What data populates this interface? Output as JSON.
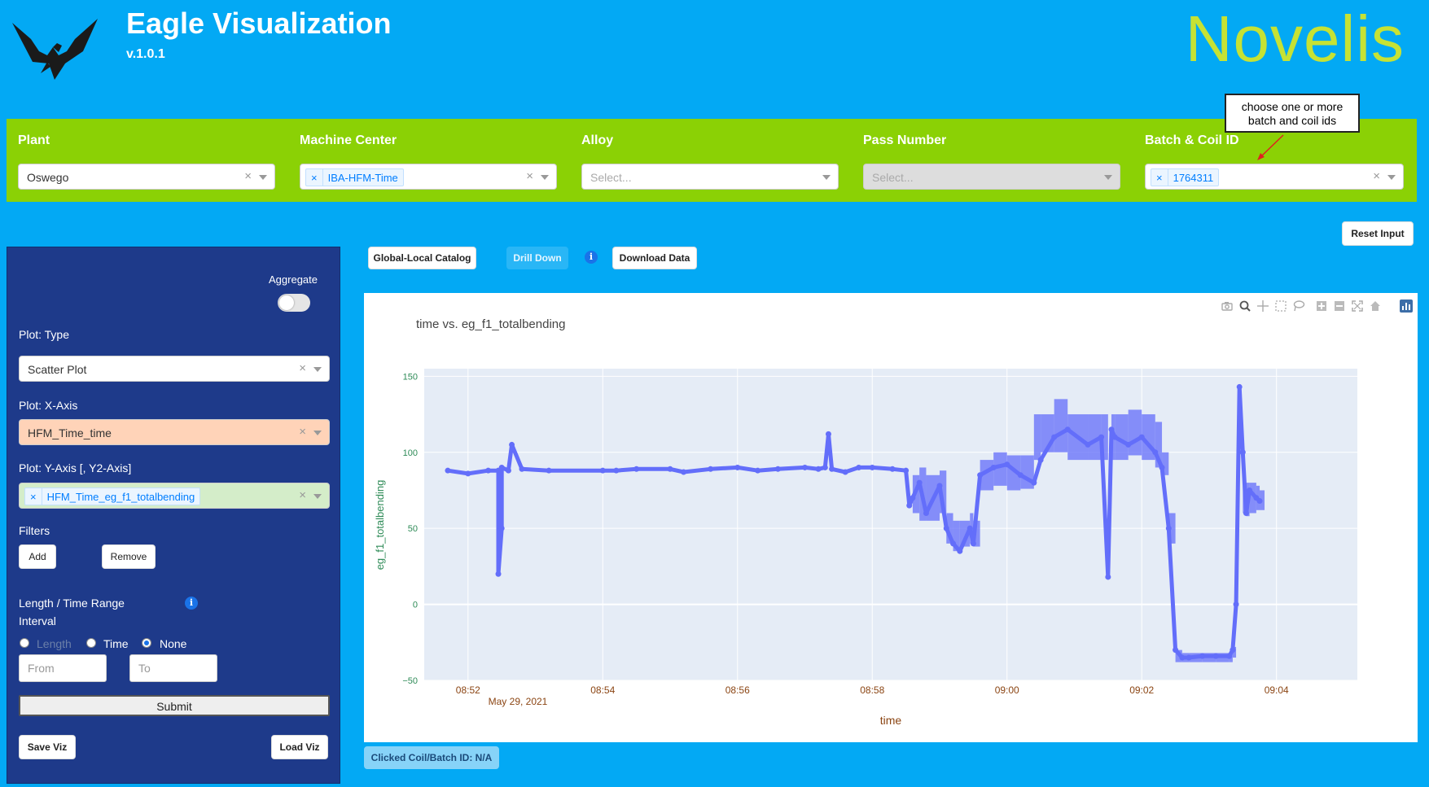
{
  "header": {
    "title": "Eagle Visualization",
    "version": "v.1.0.1",
    "brand": "Novelis"
  },
  "filters": {
    "plant": {
      "label": "Plant",
      "value": "Oswego"
    },
    "machine_center": {
      "label": "Machine Center",
      "chip": "IBA-HFM-Time"
    },
    "alloy": {
      "label": "Alloy",
      "placeholder": "Select..."
    },
    "pass_number": {
      "label": "Pass Number",
      "placeholder": "Select..."
    },
    "batch_coil": {
      "label": "Batch & Coil ID",
      "chip": "1764311"
    }
  },
  "tooltip": "choose one or more batch and coil ids",
  "buttons": {
    "reset": "Reset Input",
    "catalog": "Global-Local Catalog",
    "drill_down": "Drill Down",
    "download": "Download Data",
    "save_viz": "Save Viz",
    "load_viz": "Load Viz",
    "add": "Add",
    "remove": "Remove",
    "submit": "Submit",
    "info_glyph": "i",
    "clear_glyph": "×"
  },
  "sidebar": {
    "aggregate": "Aggregate",
    "plot_type_label": "Plot: Type",
    "plot_type_value": "Scatter Plot",
    "x_axis_label": "Plot: X-Axis",
    "x_axis_value": "HFM_Time_time",
    "y_axis_label": "Plot: Y-Axis [, Y2-Axis]",
    "y_axis_chip": "HFM_Time_eg_f1_totalbending",
    "filters_label": "Filters",
    "range_label_1": "Length / Time Range",
    "range_label_2": "Interval",
    "radio_length": "Length",
    "radio_time": "Time",
    "radio_none": "None",
    "from_placeholder": "From",
    "to_placeholder": "To"
  },
  "status": "Clicked Coil/Batch ID: N/A",
  "colors": {
    "background": "#03A9F4",
    "filter_bar": "#8BD105",
    "sidebar": "#1E3A8A",
    "brand": "#C6E234",
    "series": "#636EFA",
    "plot_bg": "#E5ECF6"
  },
  "icons": [
    "eagle-logo",
    "camera-icon",
    "zoom-icon",
    "pan-icon",
    "box-select-icon",
    "lasso-icon",
    "zoom-in-icon",
    "zoom-out-icon",
    "autoscale-icon",
    "home-icon",
    "plotly-logo-icon"
  ],
  "chart_data": {
    "type": "scatter",
    "title": "time vs. eg_f1_totalbending",
    "xlabel": "time",
    "ylabel": "eg_f1_totalbending",
    "x_ticks": [
      "08:52",
      "08:54",
      "08:56",
      "08:58",
      "09:00",
      "09:02",
      "09:04"
    ],
    "x_date_label": "May 29, 2021",
    "y_ticks": [
      "150",
      "100",
      "50",
      "0",
      "−50"
    ],
    "ylim": [
      -50,
      155
    ],
    "xlim_minutes": [
      51.35,
      65.2
    ],
    "grid": true,
    "series": [
      {
        "x": [
          51.7,
          52.0,
          52.3,
          52.45,
          52.45,
          52.5,
          52.5,
          52.6,
          52.65,
          52.8,
          53.2,
          54.0,
          54.2,
          54.5,
          55.0,
          55.2,
          55.6,
          56.0,
          56.3,
          56.6,
          57.0,
          57.2,
          57.3,
          57.35,
          57.4,
          57.6,
          57.8,
          58.0,
          58.3,
          58.5,
          58.55,
          58.6,
          58.7,
          58.8,
          59.0,
          59.1,
          59.2,
          59.3,
          59.45,
          59.5,
          59.6,
          59.8,
          60.0,
          60.2,
          60.4,
          60.5,
          60.7,
          60.9,
          61.2,
          61.4,
          61.5,
          61.55,
          61.6,
          61.8,
          62.0,
          62.2,
          62.3,
          62.4,
          62.5,
          62.6,
          62.7,
          62.9,
          63.1,
          63.3,
          63.35,
          63.4,
          63.45,
          63.5,
          63.55,
          63.6,
          63.7,
          63.75
        ],
        "y": [
          88,
          86,
          88,
          88,
          20,
          50,
          90,
          88,
          105,
          89,
          88,
          88,
          88,
          89,
          89,
          87,
          89,
          90,
          88,
          89,
          90,
          89,
          90,
          112,
          89,
          87,
          90,
          90,
          89,
          88,
          65,
          70,
          80,
          60,
          78,
          50,
          40,
          35,
          50,
          40,
          85,
          90,
          92,
          85,
          80,
          95,
          110,
          115,
          105,
          110,
          18,
          115,
          110,
          105,
          110,
          100,
          90,
          50,
          -30,
          -35,
          -35,
          -34,
          -34,
          -34,
          -30,
          0,
          143,
          100,
          60,
          75,
          70,
          68
        ],
        "band_low": [
          null,
          null,
          null,
          null,
          null,
          null,
          null,
          null,
          null,
          null,
          null,
          null,
          null,
          null,
          null,
          null,
          null,
          null,
          null,
          null,
          null,
          null,
          null,
          null,
          null,
          null,
          null,
          null,
          null,
          null,
          null,
          60,
          55,
          55,
          60,
          40,
          35,
          38,
          40,
          38,
          75,
          78,
          75,
          76,
          95,
          100,
          100,
          95,
          95,
          95,
          null,
          95,
          95,
          98,
          95,
          90,
          85,
          40,
          -38,
          -38,
          -38,
          -38,
          -38,
          -38,
          -35,
          null,
          null,
          60,
          58,
          60,
          62,
          62
        ],
        "band_high": [
          null,
          null,
          null,
          null,
          null,
          null,
          null,
          null,
          null,
          null,
          null,
          null,
          null,
          null,
          null,
          null,
          null,
          null,
          null,
          null,
          null,
          null,
          null,
          null,
          null,
          null,
          null,
          null,
          null,
          null,
          null,
          85,
          90,
          85,
          88,
          60,
          55,
          55,
          60,
          55,
          95,
          100,
          98,
          98,
          125,
          125,
          135,
          125,
          125,
          125,
          null,
          125,
          125,
          128,
          125,
          120,
          100,
          60,
          -30,
          -32,
          -32,
          -32,
          -32,
          -32,
          -28,
          null,
          null,
          80,
          80,
          80,
          78,
          75
        ]
      }
    ]
  }
}
